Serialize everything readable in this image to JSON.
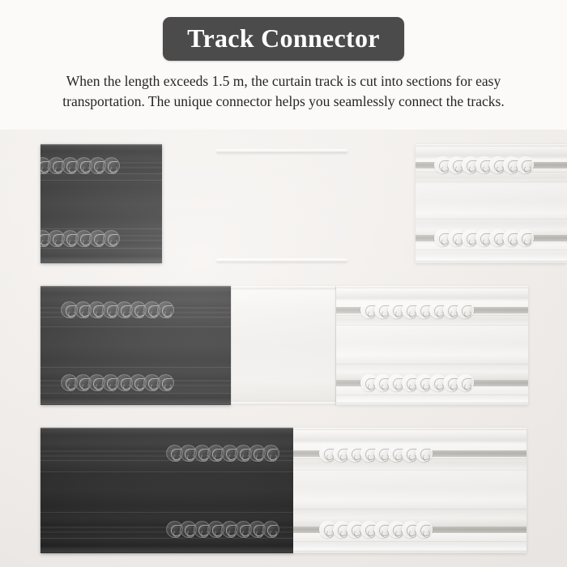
{
  "header": {
    "title": "Track Connector",
    "title_badge_color": "#4B4B4B",
    "title_text_color": "#FFFFFF",
    "description": "When the length exceeds 1.5 m, the curtain track is cut into sections for easy transportation. The unique connector helps you seamlessly connect the tracks."
  },
  "palette": {
    "background": "#FAF8F6",
    "photo_background": "#F3EFEC",
    "black_track": "#101010",
    "white_track": "#F5F3F0",
    "rail_grey": "#B8B5B0",
    "body_text": "#262626"
  },
  "photo": {
    "caption": "Curtain track sections joined by connector",
    "rows": [
      {
        "name": "row-top",
        "label": "Top row: black track left, connector rails center, white track right",
        "black_track": {
          "label": "black-curtain-track-left",
          "glider_count": 6,
          "glider_style": "dark"
        },
        "connector_rails": {
          "label": "connector-rail-pair",
          "count": 2
        },
        "white_track": {
          "label": "white-curtain-track-right",
          "glider_count": 7,
          "glider_style": "light"
        }
      },
      {
        "name": "row-middle",
        "label": "Middle row: black track joined to white track via white connector body",
        "black_track": {
          "label": "black-curtain-track-left",
          "glider_count": 8,
          "glider_style": "dark"
        },
        "connector_body": {
          "label": "track-connector-body"
        },
        "white_track": {
          "label": "white-curtain-track-right",
          "glider_count": 8,
          "glider_style": "light"
        }
      },
      {
        "name": "row-bottom",
        "label": "Bottom row: black and white tracks fully connected end to end",
        "black_track": {
          "label": "black-curtain-track-left",
          "glider_count": 8,
          "glider_style": "dark"
        },
        "white_track": {
          "label": "white-curtain-track-right",
          "glider_count": 8,
          "glider_style": "light"
        }
      }
    ]
  }
}
